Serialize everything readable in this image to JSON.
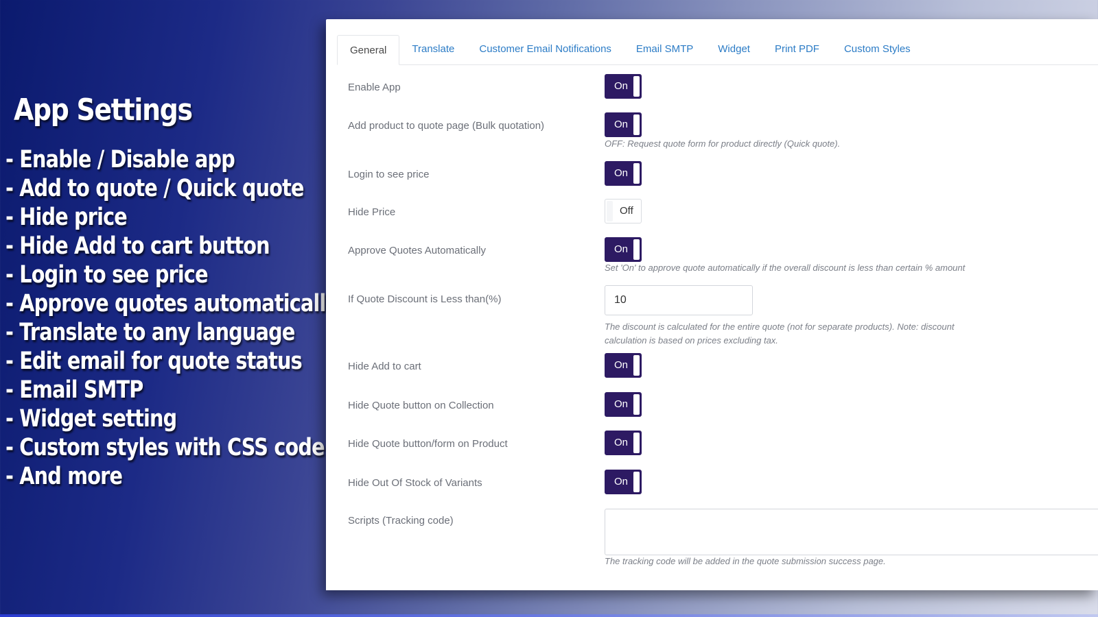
{
  "promo": {
    "title": "App Settings",
    "items": [
      "- Enable / Disable app",
      "- Add to quote / Quick quote",
      "- Hide price",
      "- Hide Add to cart button",
      "- Login to see price",
      "- Approve quotes automatically",
      "- Translate to any language",
      "- Edit email for quote status",
      "- Email SMTP",
      "- Widget setting",
      "- Custom styles with CSS code",
      "- And more"
    ]
  },
  "tabs": [
    {
      "label": "General",
      "active": true
    },
    {
      "label": "Translate",
      "active": false
    },
    {
      "label": "Customer Email Notifications",
      "active": false
    },
    {
      "label": "Email SMTP",
      "active": false
    },
    {
      "label": "Widget",
      "active": false
    },
    {
      "label": "Print PDF",
      "active": false
    },
    {
      "label": "Custom Styles",
      "active": false
    }
  ],
  "settings": {
    "enable_app": {
      "label": "Enable App",
      "state": "On"
    },
    "bulk_quotation": {
      "label": "Add product to quote page (Bulk quotation)",
      "state": "On",
      "help": "OFF: Request quote form for product directly (Quick quote)."
    },
    "login_to_see_price": {
      "label": "Login to see price",
      "state": "On"
    },
    "hide_price": {
      "label": "Hide Price",
      "state": "Off"
    },
    "approve_auto": {
      "label": "Approve Quotes Automatically",
      "state": "On",
      "help": "Set 'On' to approve quote automatically if the overall discount is less than certain % amount"
    },
    "discount": {
      "label": "If Quote Discount is Less than(%)",
      "value": "10",
      "help_line1": "The discount is calculated for the entire quote (not for separate products). Note: discount",
      "help_line2": "calculation is based on prices excluding tax."
    },
    "hide_add_to_cart": {
      "label": "Hide Add to cart",
      "state": "On"
    },
    "hide_quote_collection": {
      "label": "Hide Quote button on Collection",
      "state": "On"
    },
    "hide_quote_product": {
      "label": "Hide Quote button/form on Product",
      "state": "On"
    },
    "hide_out_of_stock": {
      "label": "Hide Out Of Stock of Variants",
      "state": "On"
    },
    "scripts": {
      "label": "Scripts (Tracking code)",
      "value": "",
      "help": "The tracking code will be added in the quote submission success page."
    }
  },
  "colors": {
    "toggle_on": "#2d1a63",
    "tab_link": "#2c7cc6",
    "label_text": "#6b6f78"
  }
}
